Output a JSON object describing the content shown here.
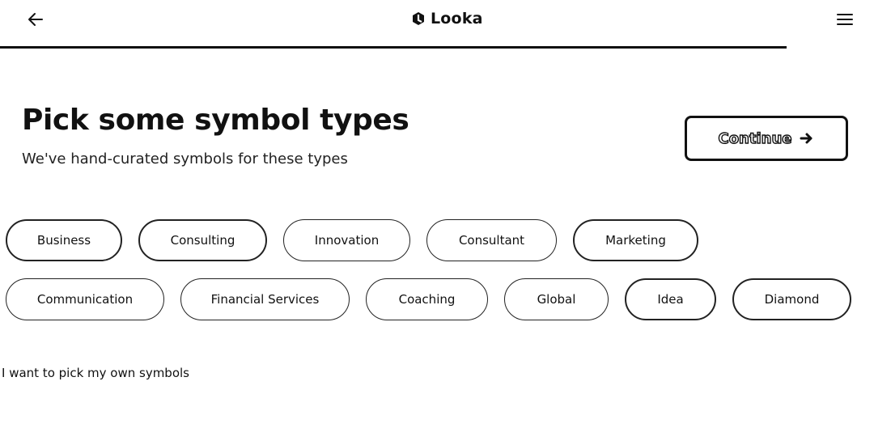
{
  "header": {
    "brand": "Looka",
    "back_icon": "arrow-left-icon",
    "menu_icon": "hamburger-menu-icon",
    "logo_icon": "looka-logo-icon",
    "progress": 0.9
  },
  "title": "Pick some symbol types",
  "subtitle": "We've hand-curated symbols for these types",
  "continue_label": "Continue",
  "continue_icon": "arrow-right-icon",
  "chips": {
    "row1": [
      {
        "label": "Business",
        "selected": true
      },
      {
        "label": "Consulting",
        "selected": true
      },
      {
        "label": "Innovation",
        "selected": false
      },
      {
        "label": "Consultant",
        "selected": false
      },
      {
        "label": "Marketing",
        "selected": true
      }
    ],
    "row2": [
      {
        "label": "Communication",
        "selected": false
      },
      {
        "label": "Financial Services",
        "selected": false
      },
      {
        "label": "Coaching",
        "selected": false
      },
      {
        "label": "Global",
        "selected": false
      },
      {
        "label": "Idea",
        "selected": true
      },
      {
        "label": "Diamond",
        "selected": true
      }
    ]
  },
  "own_symbols_link": "I want to pick my own symbols"
}
